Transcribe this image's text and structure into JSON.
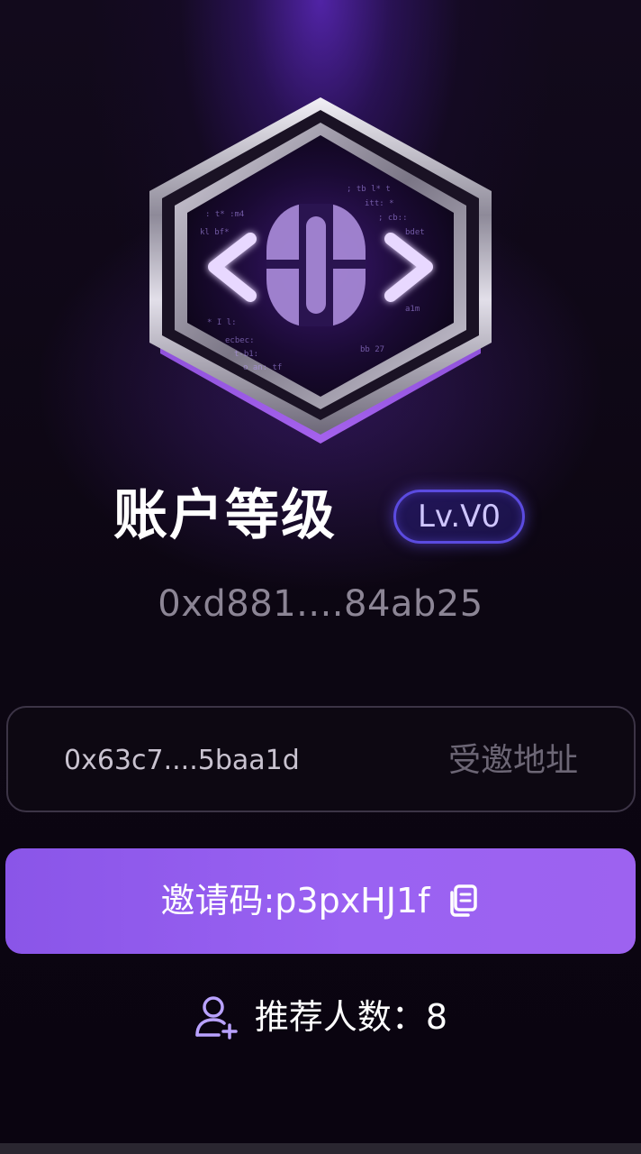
{
  "account": {
    "title": "账户等级",
    "level": "Lv.V0",
    "wallet_address": "0xd881....84ab25"
  },
  "invited": {
    "address": "0x63c7....5baa1d",
    "label": "受邀地址"
  },
  "invite_code": {
    "text": "邀请码:p3pxHJ1f"
  },
  "referrals": {
    "text": "推荐人数：8"
  },
  "icons": {
    "badge": "code-badge-icon",
    "copy": "copy-icon",
    "add_user": "add-user-icon"
  },
  "colors": {
    "accent": "#9a62f2",
    "level_border": "#5b4be0",
    "background": "#0b0510"
  }
}
